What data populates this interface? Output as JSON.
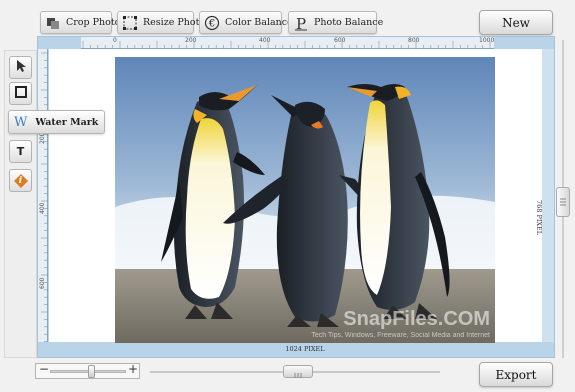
{
  "toolbar": {
    "crop_label": "Crop Photo",
    "resize_label": "Resize Photo",
    "color_label": "Color Balance",
    "photo_balance_label": "Photo Balance",
    "new_label": "New"
  },
  "sidebar": {
    "tools": [
      {
        "name": "select-arrow-icon"
      },
      {
        "name": "rectangle-icon"
      },
      {
        "name": "text-icon",
        "glyph": "T"
      },
      {
        "name": "info-icon",
        "glyph": "i"
      }
    ],
    "watermark": {
      "icon": "W",
      "label": "Water Mark"
    }
  },
  "ruler": {
    "top_ticks": [
      "0",
      "200",
      "400",
      "600",
      "800",
      "1000"
    ],
    "left_ticks": [
      "200",
      "400",
      "600"
    ]
  },
  "canvas": {
    "width_label": "1024 PIXEL",
    "height_label": "768 PIXEL",
    "watermark_text": "SnapFiles.COM",
    "watermark_subtext": "Tech Tips, Windows, Freeware, Social Media and Internet"
  },
  "bottom": {
    "zoom_minus": "−",
    "zoom_plus": "+",
    "export_label": "Export"
  },
  "colors": {
    "canvas_border": "#b9d4e8",
    "accent": "#3a7fc4",
    "info_orange": "#e07a1f"
  }
}
